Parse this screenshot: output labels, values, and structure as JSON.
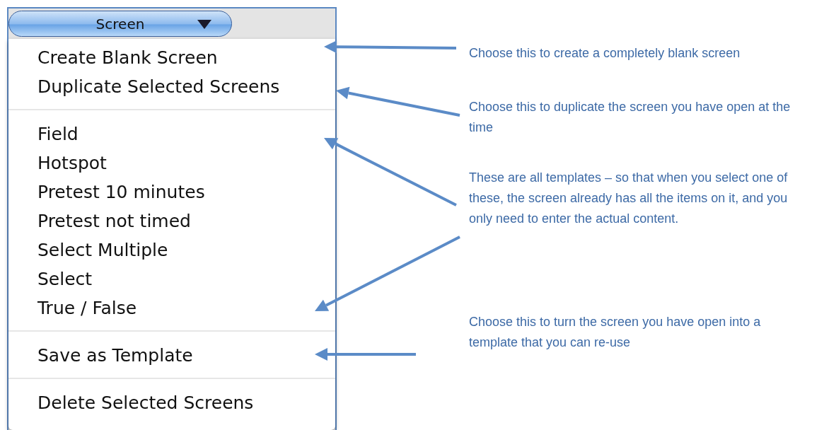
{
  "screen_button": {
    "label": "Screen"
  },
  "menu": {
    "sections": [
      {
        "items": [
          "Create Blank Screen",
          "Duplicate Selected Screens"
        ]
      },
      {
        "items": [
          "Field",
          "Hotspot",
          "Pretest 10 minutes",
          "Pretest not timed",
          "Select Multiple",
          "Select",
          "True / False"
        ]
      },
      {
        "items": [
          "Save as Template"
        ]
      },
      {
        "items": [
          "Delete Selected Screens"
        ]
      }
    ]
  },
  "annotations": [
    {
      "text": "Choose this to create a completely blank screen"
    },
    {
      "text": "Choose this to duplicate the screen you have open at the time"
    },
    {
      "text": "These are all templates – so that when you select one of these, the screen already has all the items on it, and you only need to enter the actual content."
    },
    {
      "text": "Choose this to turn the screen you have open into a template that you can re-use"
    }
  ]
}
